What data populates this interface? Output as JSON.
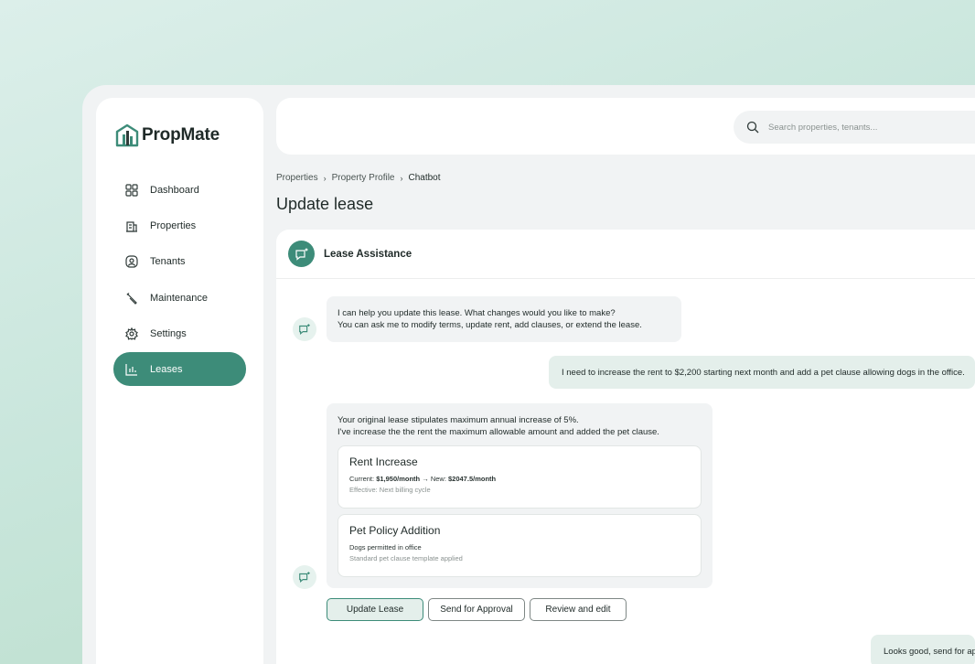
{
  "app": {
    "name": "PropMate"
  },
  "sidebar": {
    "items": [
      {
        "label": "Dashboard",
        "icon": "grid-icon"
      },
      {
        "label": "Properties",
        "icon": "building-icon"
      },
      {
        "label": "Tenants",
        "icon": "user-icon"
      },
      {
        "label": "Maintenance",
        "icon": "wrench-icon"
      },
      {
        "label": "Settings",
        "icon": "gear-icon"
      },
      {
        "label": "Leases",
        "icon": "chart-icon",
        "active": true
      }
    ]
  },
  "search": {
    "placeholder": "Search properties, tenants..."
  },
  "breadcrumb": {
    "items": [
      "Properties",
      "Property Profile",
      "Chatbot"
    ]
  },
  "page": {
    "title": "Update lease"
  },
  "chat": {
    "header": "Lease Assistance",
    "messages": {
      "bot1": {
        "line1": "I can help you update this lease. What changes would you like to make?",
        "line2": "You can ask me to modify terms, update rent, add clauses, or extend the lease."
      },
      "user1": "I need to increase the rent to $2,200 starting next month and add a pet clause allowing dogs in the office.",
      "bot2": {
        "line1": "Your original lease stipulates maximum annual increase of 5%.",
        "line2": "I've increase the the rent the maximum allowable amount and added the pet clause.",
        "cards": [
          {
            "title": "Rent Increase",
            "current_label": "Current:",
            "current_value": "$1,950/month",
            "arrow": "→",
            "new_label": "New:",
            "new_value": "$2047.5/month",
            "sub": "Effective: Next billing cycle"
          },
          {
            "title": "Pet Policy Addition",
            "line": "Dogs permitted in office",
            "sub": "Standard pet clause template applied"
          }
        ]
      },
      "user2": "Looks good, send for approval"
    },
    "actions": {
      "update": "Update Lease",
      "approval": "Send for Approval",
      "review": "Review and edit"
    }
  },
  "colors": {
    "accent": "#3d8c79",
    "accent_light": "#e4efeb",
    "background": "#f1f3f4"
  }
}
